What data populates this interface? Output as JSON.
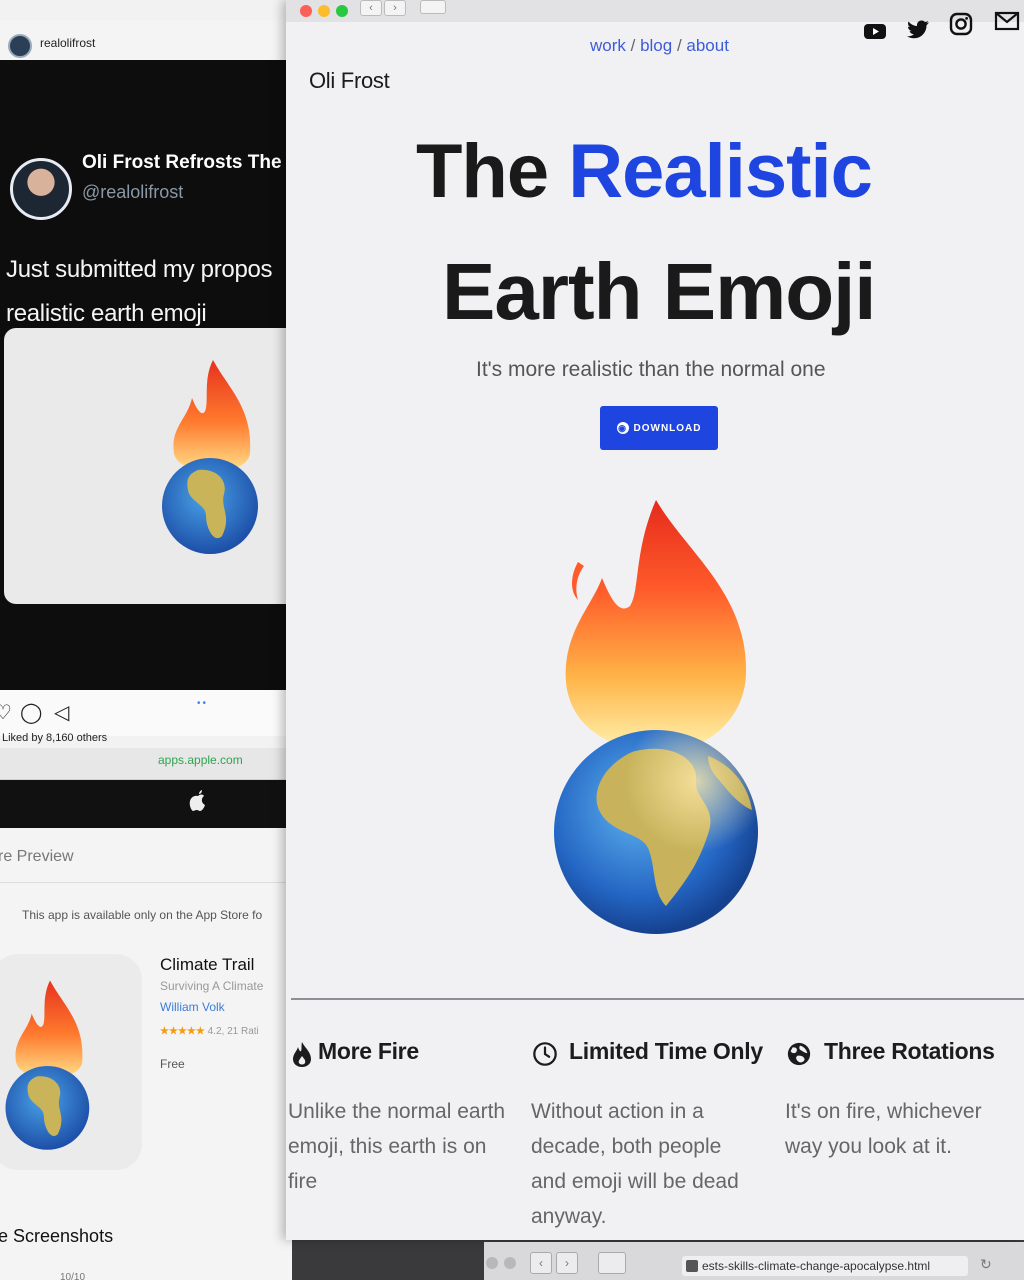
{
  "left_window": {
    "header_username": "realolifrost",
    "post": {
      "name": "Oli Frost Refrosts The P",
      "handle": "@realolifrost",
      "text": "Just submitted my propos\nrealistic earth emoji"
    },
    "liked_by": "Liked by 8,160 others",
    "browser_url": "apps.apple.com",
    "store": {
      "section_preview": "re Preview",
      "availability": "This app is available only on the App Store fo",
      "app_name": "Climate Trail",
      "app_subtitle": "Surviving A Climate",
      "developer": "William Volk",
      "rating_stars": "★★★★★",
      "rating_text": "4.2, 21 Rati",
      "price": "Free",
      "section_screenshots": "e Screenshots",
      "date_fragment": "10/10"
    }
  },
  "site": {
    "logo": "Oli Frost",
    "nav": {
      "work": "work",
      "blog": "blog",
      "about": "about",
      "separator": " / "
    },
    "social_icons": [
      "youtube-icon",
      "twitter-icon",
      "instagram-icon",
      "mail-icon"
    ],
    "hero": {
      "title_part1": "The ",
      "title_accent": "Realistic",
      "title_line2": "Earth Emoji",
      "subtitle": "It's more realistic than the normal one",
      "download_label": "DOWNLOAD"
    },
    "features": [
      {
        "icon": "flame-icon",
        "title": "More Fire",
        "text": "Unlike the normal earth\nemoji, this earth is on\nfire"
      },
      {
        "icon": "clock-icon",
        "title": "Limited Time Only",
        "text": "Without action in a\ndecade, both people\nand emoji will be dead\nanyway."
      },
      {
        "icon": "globe-icon",
        "title": "Three Rotations",
        "text": "It's on fire, whichever\nway you look at it."
      }
    ]
  },
  "bottom_bar": {
    "url": "ests-skills-climate-change-apocalypse.html"
  },
  "colors": {
    "accent": "#1f45e0",
    "page_bg": "#f1f1f4",
    "text_dark": "#1a1a1a",
    "text_muted": "#666666"
  }
}
